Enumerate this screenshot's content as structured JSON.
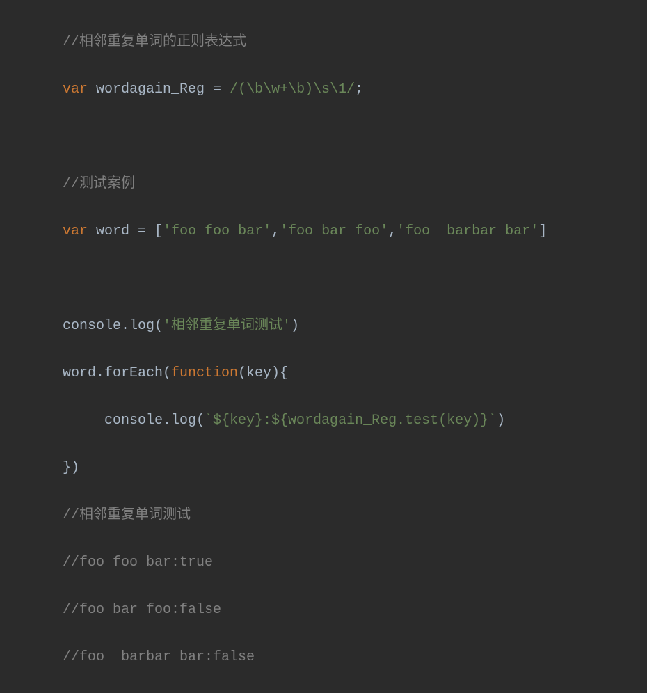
{
  "code": {
    "line1_comment": "//相邻重复单词的正则表达式",
    "line2_var": "var",
    "line2_name": " wordagain_Reg ",
    "line2_eq": "= ",
    "line2_regex": "/(\\b\\w+\\b)\\s\\1/",
    "line2_semi": ";",
    "line4_comment": "//测试案例",
    "line5_var": "var",
    "line5_name": " word ",
    "line5_eq": "= ",
    "line5_lbracket": "[",
    "line5_str1": "'foo foo bar'",
    "line5_comma1": ",",
    "line5_str2": "'foo bar foo'",
    "line5_comma2": ",",
    "line5_str3": "'foo  barbar bar'",
    "line6_rbracket": "]",
    "line8_consolelog": "console.log(",
    "line8_str": "'相邻重复单词测试'",
    "line8_close": ")",
    "line9_prefix": "word.forEach(",
    "line9_function": "function",
    "line9_after": "(key){",
    "line10_consolelog": "console.log(",
    "line10_tmpl": "`${key}:${wordagain_Reg.test(key)}`",
    "line10_close": ")",
    "line11_close": "})",
    "line12_comment": "//相邻重复单词测试",
    "line13_comment": "//foo foo bar:true",
    "line14_comment": "//foo bar foo:false",
    "line15_comment": "//foo  barbar bar:false"
  }
}
